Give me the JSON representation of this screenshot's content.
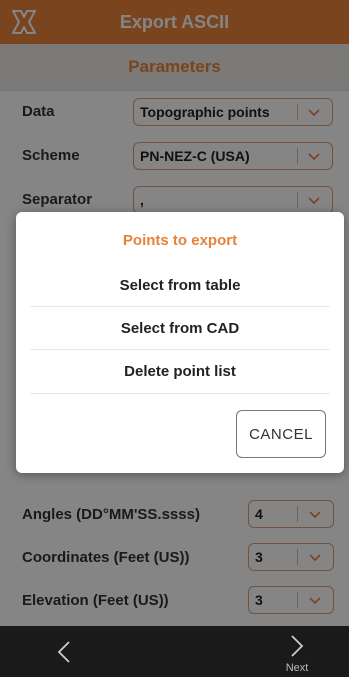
{
  "header": {
    "title": "Export ASCII",
    "logo": "app-logo-icon"
  },
  "parameters": {
    "title": "Parameters",
    "rows": [
      {
        "label": "Data",
        "value": "Topographic points"
      },
      {
        "label": "Scheme",
        "value": "PN-NEZ-C (USA)"
      },
      {
        "label": "Separator",
        "value": ","
      }
    ],
    "precision_rows": [
      {
        "label": "Angles (DD°MM'SS.ssss)",
        "value": "4"
      },
      {
        "label": "Coordinates (Feet (US))",
        "value": "3"
      },
      {
        "label": "Elevation (Feet (US))",
        "value": "3"
      }
    ]
  },
  "dialog": {
    "title": "Points to export",
    "options": [
      "Select from table",
      "Select from CAD",
      "Delete point list"
    ],
    "cancel_label": "CANCEL"
  },
  "bottom_bar": {
    "next_label": "Next"
  },
  "colors": {
    "accent": "#e8823a",
    "bottom_bar": "#1a1a1a"
  }
}
